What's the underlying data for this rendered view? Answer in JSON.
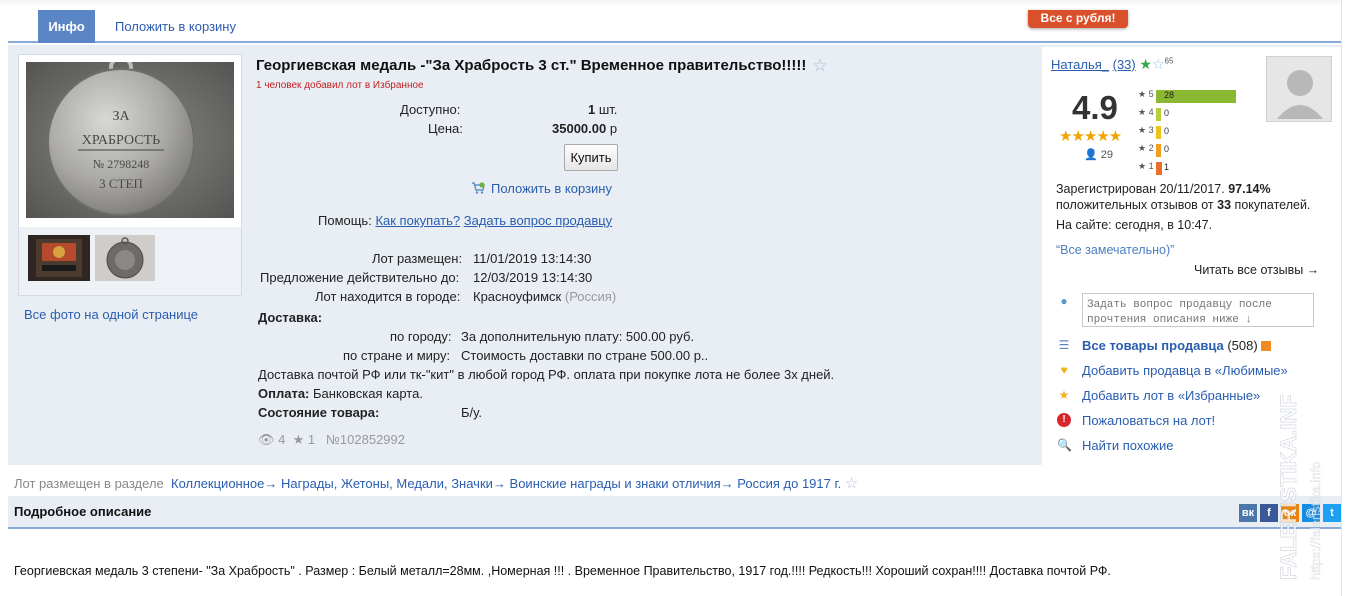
{
  "tabs": {
    "info": "Инфо",
    "cart": "Положить в корзину"
  },
  "promo": "Все с рубля!",
  "lot": {
    "title": "Георгиевская медаль -\"За Храбрость 3 ст.\" Временное правительство!!!!!",
    "fav_note": "1 человек добавил лот в Избранное",
    "available_label": "Доступно:",
    "available_value": "1",
    "available_unit": "шт.",
    "price_label": "Цена:",
    "price_value": "35000.00",
    "price_unit": "р",
    "buy_label": "Купить",
    "cart_label": "Положить в корзину",
    "help_label": "Помощь:",
    "help_how": "Как покупать?",
    "help_ask": "Задать вопрос продавцу",
    "placed_label": "Лот размещен:",
    "placed_value": "11/01/2019 13:14:30",
    "valid_label": "Предложение действительно до:",
    "valid_value": "12/03/2019 13:14:30",
    "city_label": "Лот находится в городе:",
    "city_value": "Красноуфимск",
    "country_value": "(Россия)",
    "delivery_label": "Доставка:",
    "city_delivery_label": "по городу:",
    "city_delivery_value": "За дополнительную плату: 500.00 руб.",
    "country_delivery_label": "по стране и миру:",
    "country_delivery_value": "Стоимость доставки по стране 500.00 р..",
    "delivery_note": "Доставка почтой РФ или тк-\"кит\" в любой город РФ. оплата при покупке лота не более 3х дней.",
    "payment_label": "Оплата:",
    "payment_value": "Банковская карта.",
    "condition_label": "Состояние товара:",
    "condition_value": "Б/у.",
    "views": "4",
    "stars": "1",
    "lot_number": "№102852992"
  },
  "photos": {
    "all_label": "Все фото на одной странице",
    "medal_text": [
      "ЗА",
      "ХРАБРОСТЬ",
      "№ 2798248",
      "3 СТЕП"
    ]
  },
  "seller": {
    "name": "Наталья_",
    "count": "(33)",
    "badge_num": "65",
    "rating": "4.9",
    "reviewers": "29",
    "distribution": [
      {
        "stars": "5",
        "count": "28",
        "color": "#8bb832"
      },
      {
        "stars": "4",
        "count": "0",
        "color": "#b9cf3a"
      },
      {
        "stars": "3",
        "count": "0",
        "color": "#f0c21c"
      },
      {
        "stars": "2",
        "count": "0",
        "color": "#f0a020"
      },
      {
        "stars": "1",
        "count": "1",
        "color": "#e8702a"
      }
    ],
    "registered": "Зарегистрирован 20/11/2017.",
    "positive_pct": "97.14%",
    "positive_text_a": "положительных отзывов от",
    "positive_count": "33",
    "positive_text_b": "покупателей.",
    "online": "На сайте: сегодня, в 10:47.",
    "quote": "“Все замечательно)”",
    "read_all": "Читать все отзывы →",
    "ask_placeholder": "Задать вопрос продавцу после прочтения описания ниже ↓",
    "all_goods": "Все товары продавца",
    "all_goods_count": "(508)",
    "add_fav_seller": "Добавить продавца в «Любимые»",
    "add_fav_lot": "Добавить лот в «Избранные»",
    "complain": "Пожаловаться на лот!",
    "similar": "Найти похожие"
  },
  "breadcrumb": {
    "prefix": "Лот размещен в разделе",
    "items": [
      "Коллекционное",
      "Награды, Жетоны, Медали, Значки",
      "Воинские награды и знаки отличия",
      "Россия до 1917 г."
    ]
  },
  "description": {
    "header": "Подробное описание",
    "text": "Георгиевская медаль 3 степени- \"За Храбрость\" .  Размер : Белый металл=28мм. ,Номерная !!! . Временное Правительство, 1917 год.!!!!  Редкость!!! Хороший сохран!!!!  Доставка почтой РФ."
  },
  "socials": [
    "vk",
    "f",
    "ok",
    "mail",
    "twitter"
  ],
  "watermark": [
    "FALERISTIKA.INFO",
    "https://faleristika.info"
  ]
}
